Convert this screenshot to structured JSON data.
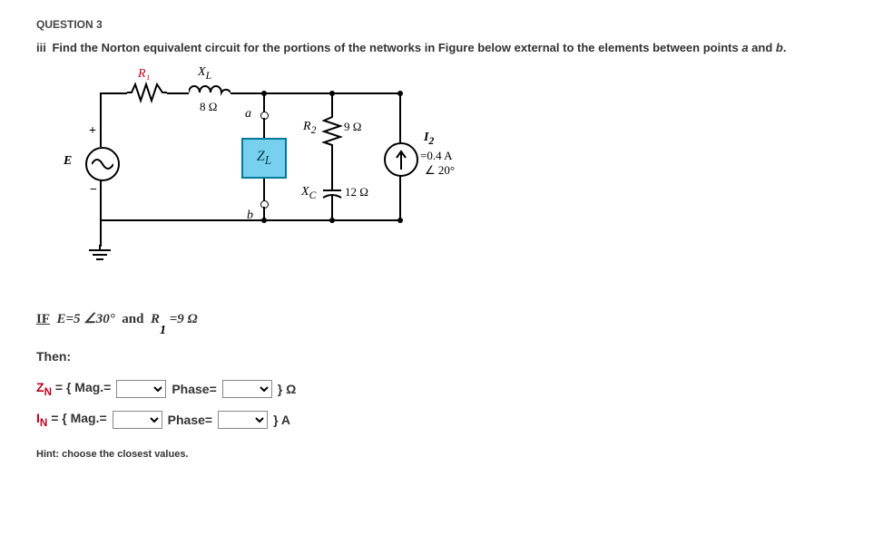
{
  "question_number": "QUESTION 3",
  "prompt_roman": "iii",
  "prompt_text": "Find the Norton equivalent circuit for the portions of the networks in Figure below external to the elements between points ",
  "prompt_a": "a",
  "prompt_and": " and ",
  "prompt_b": "b",
  "prompt_period": ".",
  "circuit": {
    "R1": "R₁",
    "XL": "X_L",
    "eightOhm": "8 Ω",
    "a": "a",
    "b": "b",
    "R2": "R₂",
    "nineOhm": "9 Ω",
    "ZL": "Z_L",
    "Xc": "X_C",
    "twelveOhm": "12 Ω",
    "I2": "I₂",
    "I2val1": "=0.4 A",
    "I2val2": "∠ 20°",
    "E": "E",
    "plus": "+",
    "minus": "−"
  },
  "condition": {
    "if": "IF",
    "expr_E": "E=5 ∠30°",
    "and": "and",
    "R": "R",
    "sub1": "1",
    "eq": "=9 Ω"
  },
  "then": "Then:",
  "rows": {
    "zn_label": "ZN = { Mag.=",
    "in_label": "IN = { Mag.=",
    "phase": "Phase=",
    "close_ohm": "}  Ω",
    "close_a": "}   A"
  },
  "hint": "Hint: choose the closest values."
}
